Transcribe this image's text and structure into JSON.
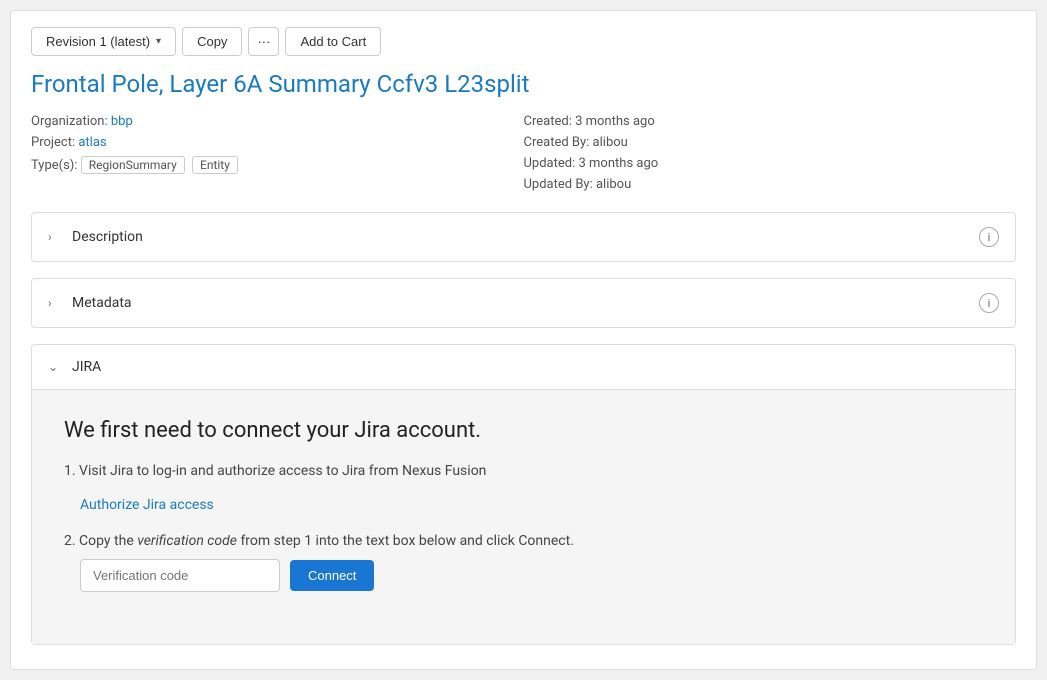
{
  "toolbar": {
    "revision_label": "Revision 1 (latest)",
    "copy_label": "Copy",
    "more_label": "···",
    "add_to_cart_label": "Add to Cart"
  },
  "page": {
    "title": "Frontal Pole, Layer 6A Summary Ccfv3 L23split"
  },
  "metadata": {
    "organization_label": "Organization:",
    "organization_value": "bbp",
    "project_label": "Project:",
    "project_value": "atlas",
    "types_label": "Type(s):",
    "types": [
      "RegionSummary",
      "Entity"
    ],
    "created_label": "Created:",
    "created_value": "3 months ago",
    "created_by_label": "Created By:",
    "created_by_value": "alibou",
    "updated_label": "Updated:",
    "updated_value": "3 months ago",
    "updated_by_label": "Updated By:",
    "updated_by_value": "alibou"
  },
  "sections": [
    {
      "id": "description",
      "label": "Description",
      "expanded": false,
      "has_info": true
    },
    {
      "id": "metadata",
      "label": "Metadata",
      "expanded": false,
      "has_info": true
    },
    {
      "id": "jira",
      "label": "JIRA",
      "expanded": true,
      "has_info": false
    }
  ],
  "jira": {
    "connect_title": "We first need to connect your Jira account.",
    "step1_text": "Visit Jira to log-in and authorize access to Jira from Nexus Fusion",
    "step1_number": "1.",
    "step2_number": "2.",
    "authorize_link": "Authorize Jira access",
    "step2_prefix": "Copy the ",
    "step2_italic": "verification code",
    "step2_suffix": " from step 1 into the text box below and click Connect.",
    "verification_placeholder": "Verification code",
    "connect_button": "Connect"
  },
  "icons": {
    "chevron_right": "›",
    "chevron_down": "⌄",
    "info": "i"
  }
}
